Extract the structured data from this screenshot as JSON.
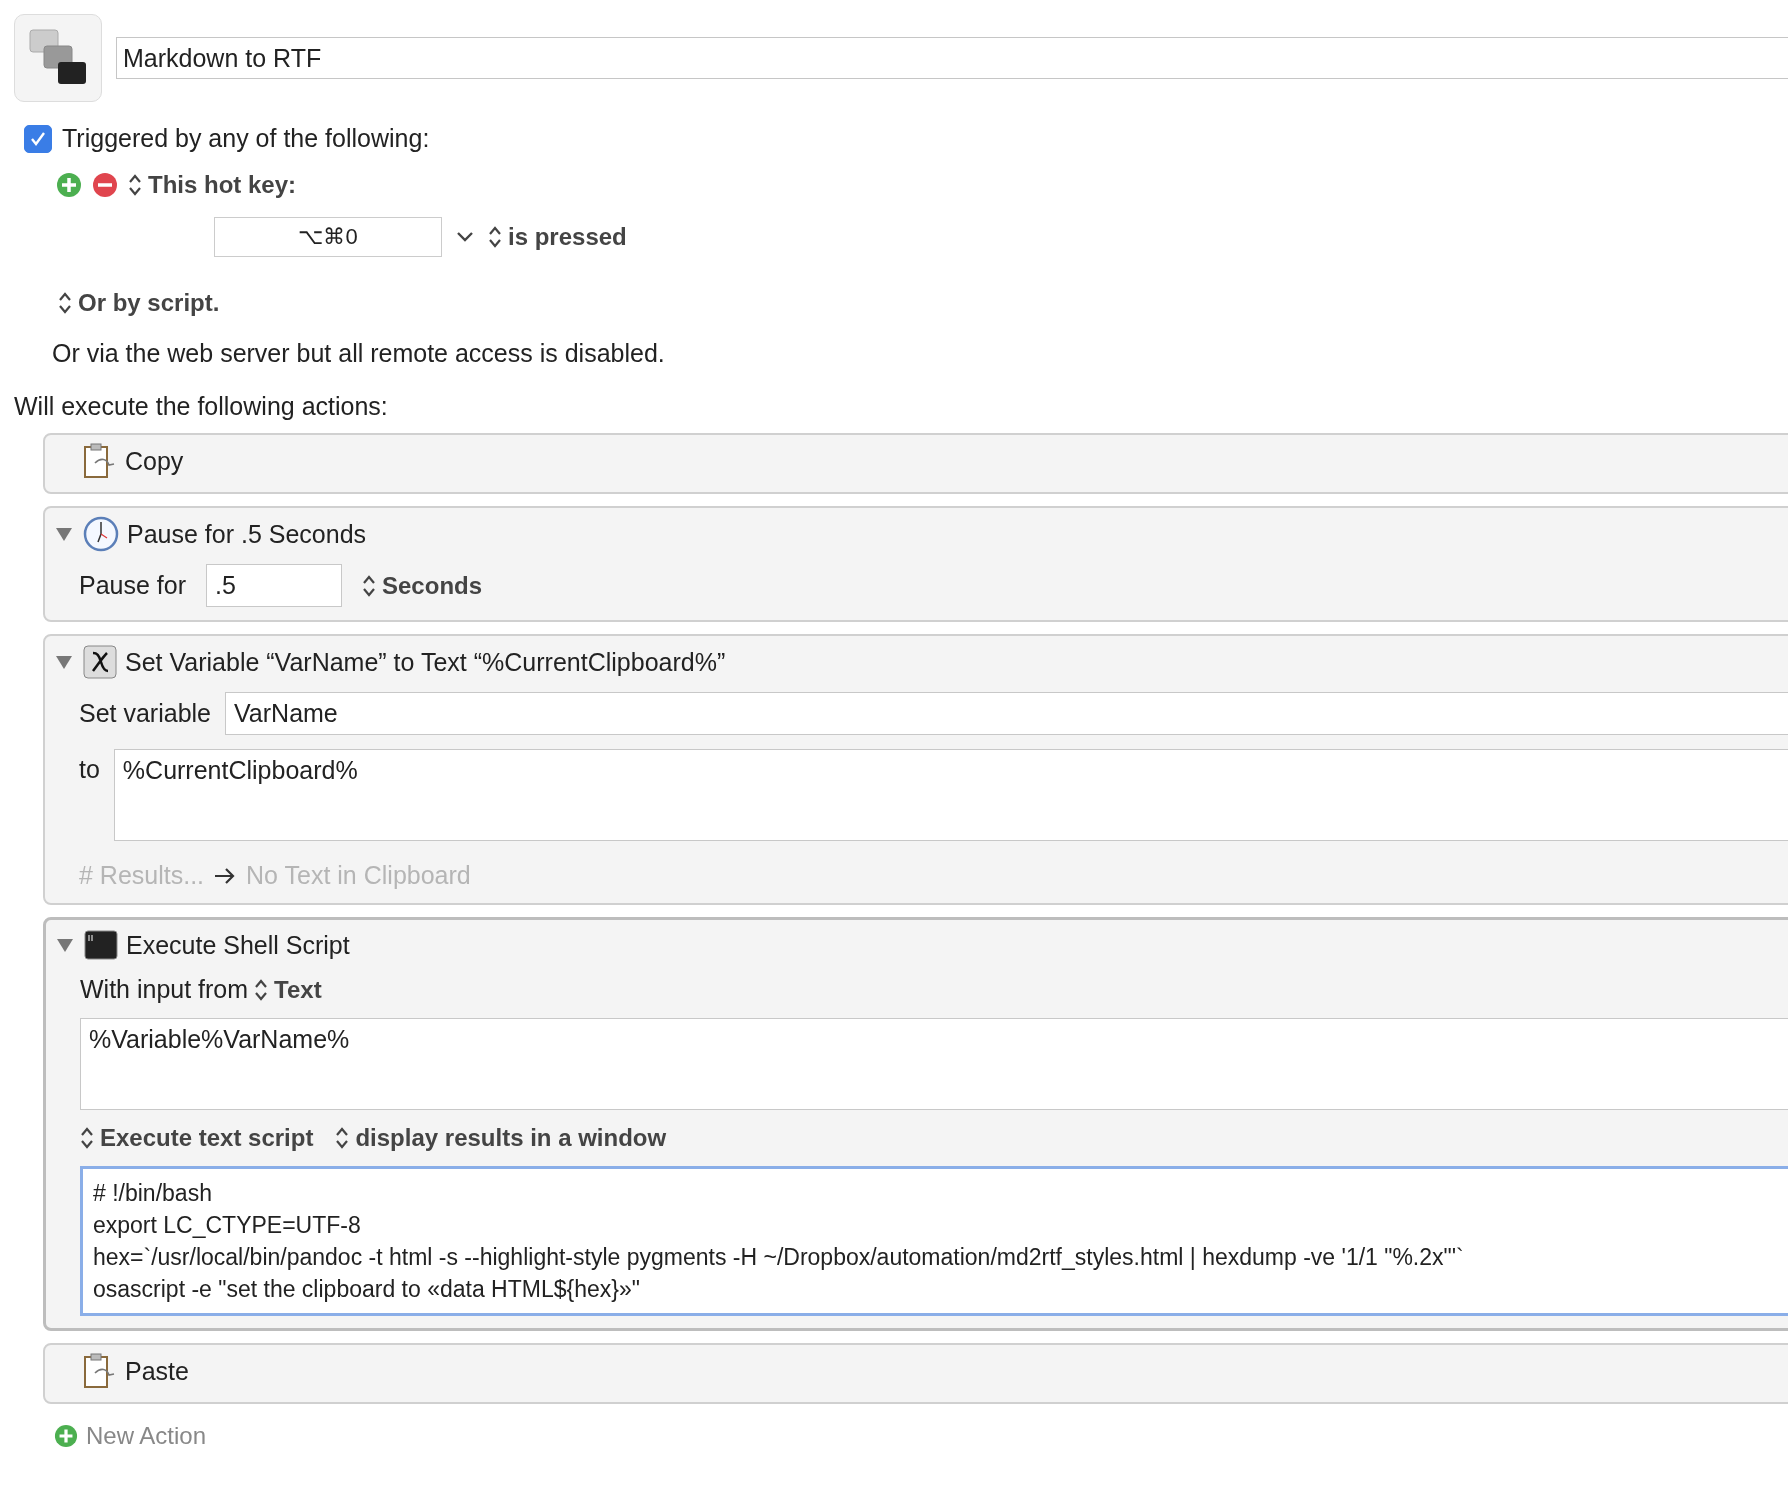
{
  "macro": {
    "name": "Markdown to RTF",
    "enabled": true,
    "trigger_heading": "Triggered by any of the following:",
    "triggers": [
      {
        "label": "This hot key:",
        "hotkey": "⌥⌘0",
        "condition": "is pressed"
      }
    ],
    "script_trigger": "Or by script.",
    "web_note": "Or via the web server but all remote access is disabled.",
    "actions_heading": "Will execute the following actions:",
    "actions": [
      {
        "kind": "clipboard",
        "title": "Copy",
        "selected": false
      },
      {
        "kind": "pause",
        "title": "Pause for .5 Seconds",
        "expanded": true,
        "selected": false,
        "label": "Pause for",
        "value": ".5",
        "unit": "Seconds"
      },
      {
        "kind": "variable",
        "title": "Set Variable “VarName” to Text “%CurrentClipboard%”",
        "expanded": true,
        "selected": false,
        "set_label": "Set variable",
        "variable": "VarName",
        "to_label": "to",
        "text": "%CurrentClipboard%",
        "results_label": "# Results...",
        "results": "No Text in Clipboard"
      },
      {
        "kind": "shell",
        "title": "Execute Shell Script",
        "expanded": true,
        "selected": true,
        "input_label": "With input from",
        "input_source": "Text",
        "input": "%Variable%VarName%",
        "mode": "Execute text script",
        "output": "display results in a window",
        "script": [
          "# !/bin/bash",
          "export LC_CTYPE=UTF-8",
          "hex=`/usr/local/bin/pandoc -t html -s --highlight-style pygments -H ~/Dropbox/automation/md2rtf_styles.html | hexdump -ve '1/1 \"%.2x\"'`",
          "osascript -e \"set the clipboard to «data HTML${hex}»\""
        ]
      },
      {
        "kind": "clipboard",
        "title": "Paste",
        "selected": false
      }
    ],
    "new_action": "New Action"
  }
}
